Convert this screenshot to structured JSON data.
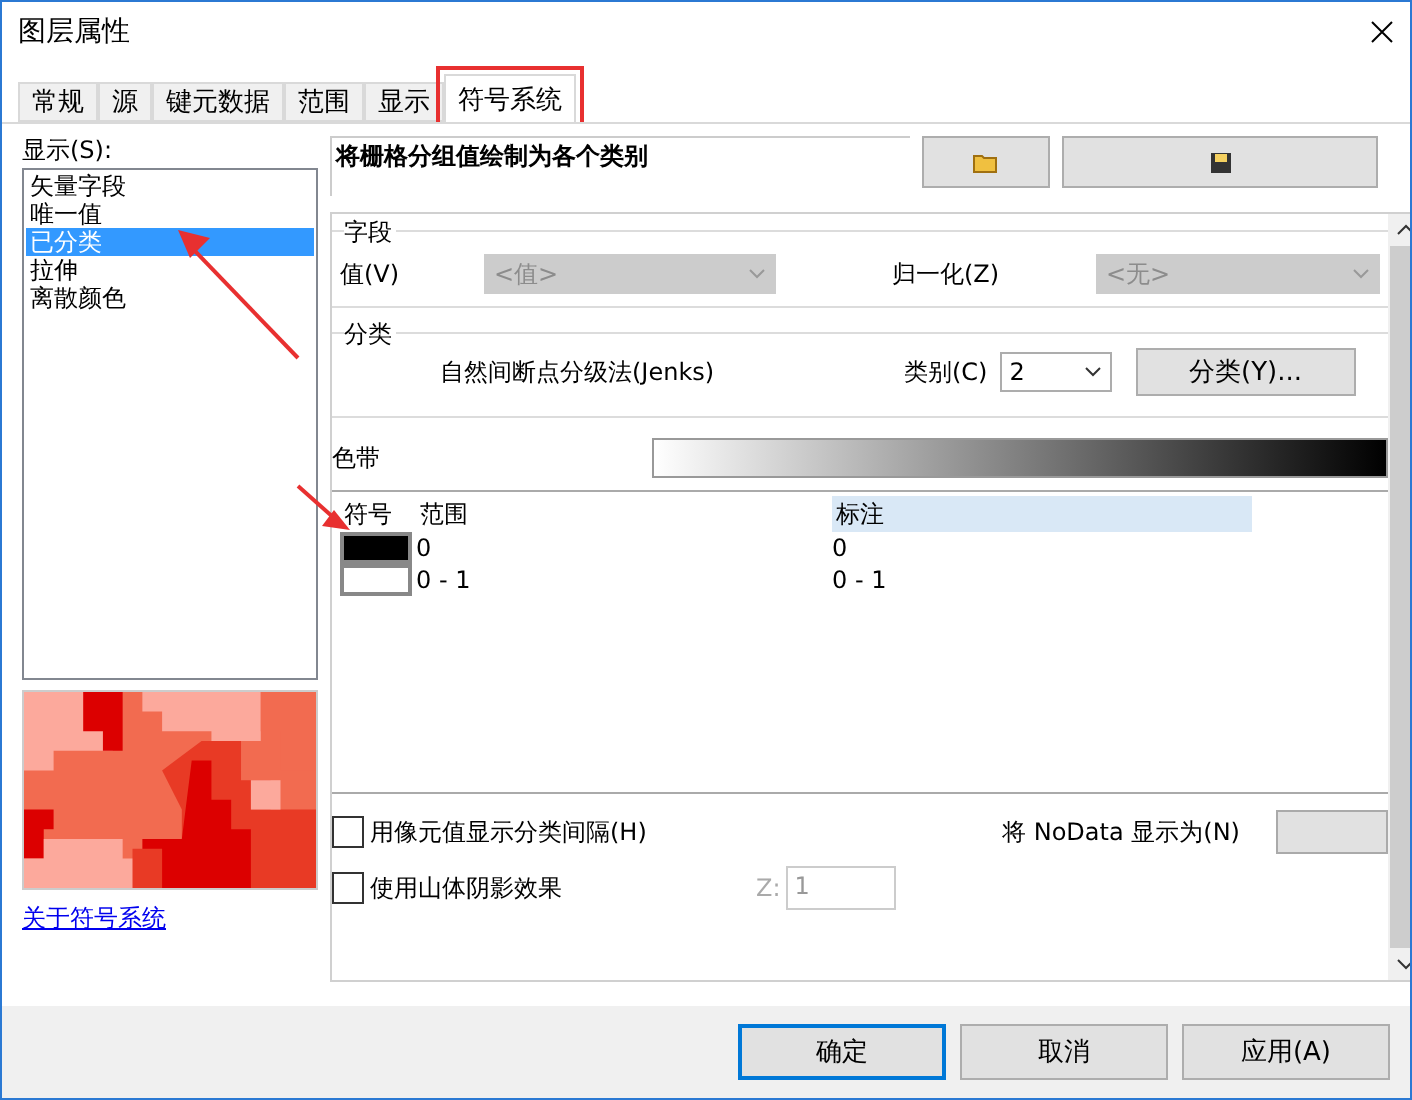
{
  "window": {
    "title": "图层属性"
  },
  "tabs": [
    {
      "label": "常规",
      "selected": false,
      "outlined": false
    },
    {
      "label": "源",
      "selected": false,
      "outlined": false
    },
    {
      "label": "键元数据",
      "selected": false,
      "outlined": false
    },
    {
      "label": "范围",
      "selected": false,
      "outlined": false
    },
    {
      "label": "显示",
      "selected": false,
      "outlined": false
    },
    {
      "label": "符号系统",
      "selected": true,
      "outlined": true
    }
  ],
  "show_label": "显示(S):",
  "renderers": [
    {
      "label": "矢量字段",
      "selected": false
    },
    {
      "label": "唯一值",
      "selected": false
    },
    {
      "label": "已分类",
      "selected": true
    },
    {
      "label": "拉伸",
      "selected": false
    },
    {
      "label": "离散颜色",
      "selected": false
    }
  ],
  "about_link": "关于符号系统",
  "description": "将栅格分组值绘制为各个类别",
  "fields": {
    "title": "字段",
    "value_label": "值(V)",
    "value": "<值>",
    "value_disabled": true,
    "normalize_label": "归一化(Z)",
    "normalize": "<无>",
    "normalize_disabled": true
  },
  "classification": {
    "title": "分类",
    "method": "自然间断点分级法(Jenks)",
    "classes_label": "类别(C)",
    "classes": "2",
    "classify_button": "分类(Y)..."
  },
  "color_ramp": {
    "label": "色带"
  },
  "table": {
    "columns": [
      {
        "label": "符号",
        "selected": false
      },
      {
        "label": "范围",
        "selected": false
      },
      {
        "label": "标注",
        "selected": true
      }
    ],
    "rows": [
      {
        "color": "#000000",
        "range": "0",
        "label": "0"
      },
      {
        "color": "#ffffff",
        "range": "0 - 1",
        "label": "0 - 1"
      }
    ]
  },
  "options": [
    {
      "label": "用像元值显示分类间隔(H)",
      "checked": false
    },
    {
      "label": "使用山体阴影效果",
      "checked": false
    }
  ],
  "z": {
    "label": "Z:",
    "value": "1",
    "disabled": true
  },
  "nodata_label": "将 NoData 显示为(N)",
  "buttons": [
    {
      "label": "确定",
      "default": true
    },
    {
      "label": "取消",
      "default": false
    },
    {
      "label": "应用(A)",
      "default": false
    }
  ]
}
